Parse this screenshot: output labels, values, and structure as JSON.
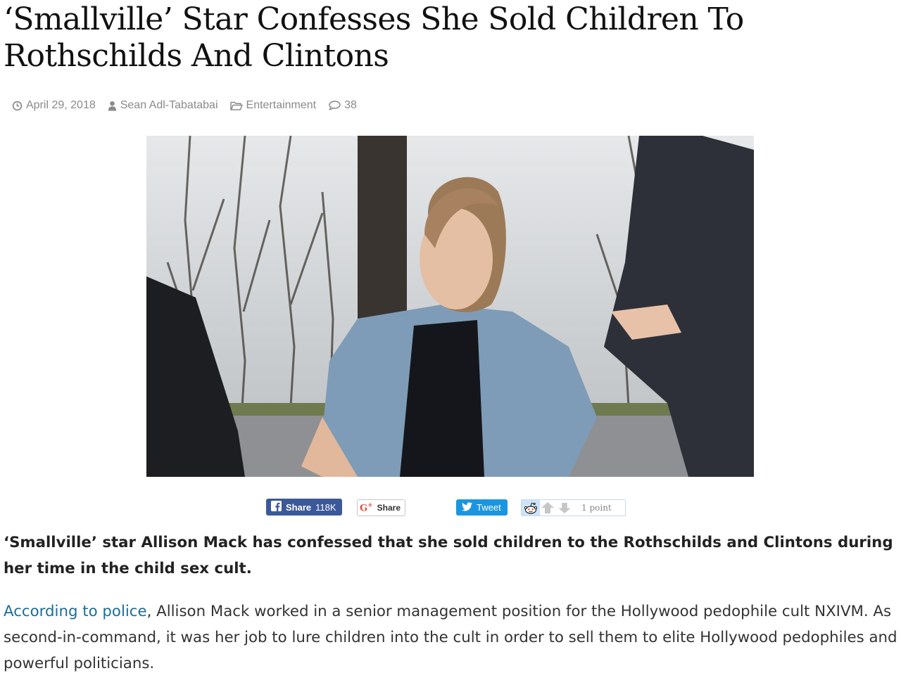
{
  "article": {
    "title": "‘Smallville’ Star Confesses She Sold Children To Rothschilds And Clintons",
    "meta": {
      "date": "April 29, 2018",
      "author": "Sean Adl-Tabatabai",
      "category": "Entertainment",
      "comments": "38"
    },
    "lead": "‘Smallville’ star Allison Mack has confessed that she sold children to the Rothschilds and Clintons during her time in the child sex cult.",
    "body": {
      "link_text": "According to police",
      "text": ", Allison Mack worked in a senior management position for the Hollywood pedophile cult NXIVM. As second-in-command, it was her job to lure children into the cult in order to sell them to elite Hollywood pedophiles and powerful politicians."
    }
  },
  "share": {
    "facebook_label": "Share",
    "facebook_count": "118K",
    "google_label": "Share",
    "twitter_label": "Tweet",
    "reddit_points": "1 point"
  },
  "icons": {
    "date": "clock-icon",
    "author": "user-icon",
    "category": "folder-icon",
    "comments": "comment-icon",
    "facebook": "facebook-icon",
    "google": "google-plus-icon",
    "twitter": "twitter-icon",
    "reddit": "reddit-alien-icon"
  },
  "colors": {
    "facebook": "#3b5998",
    "twitter": "#1b95e0",
    "link": "#1a6d9a",
    "meta": "#8a8a8a"
  }
}
